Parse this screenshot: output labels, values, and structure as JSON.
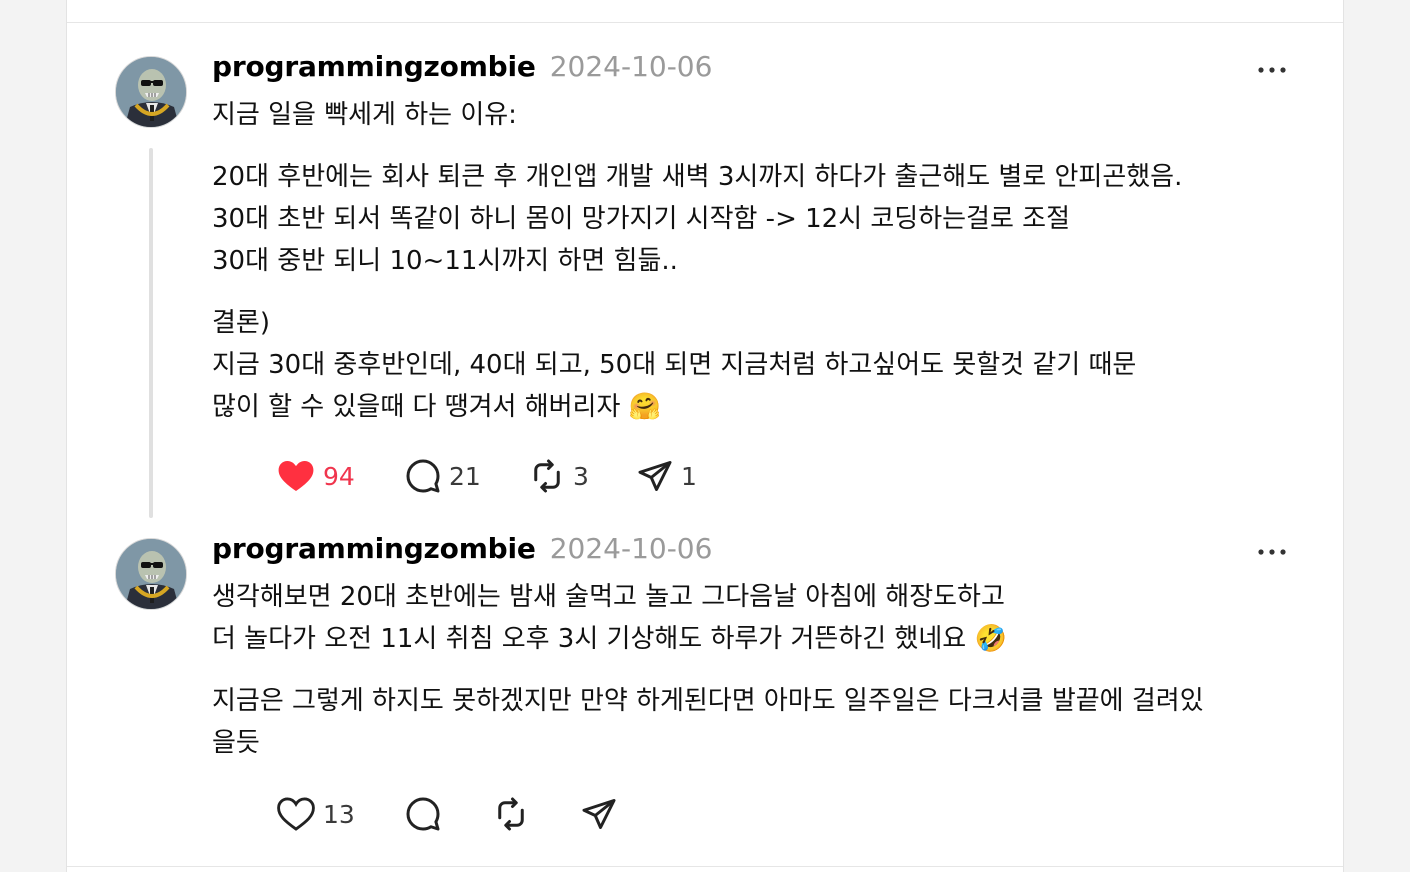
{
  "colors": {
    "like_active": "#ff3040",
    "date_gray": "#9a9a9a",
    "icon_dark": "#222222"
  },
  "posts": [
    {
      "username": "programmingzombie",
      "date": "2024-10-06",
      "more_icon": "more-dots-icon",
      "paragraphs": [
        "지금 일을 빡세게 하는 이유:",
        "20대 후반에는 회사 퇴큰 후 개인앱 개발 새벽 3시까지 하다가 출근해도 별로 안피곤했음.\n30대 초반 되서 똑같이 하니 몸이 망가지기 시작함 -> 12시 코딩하는걸로 조절\n30대 중반 되니 10~11시까지 하면 힘듦..",
        "결론)\n지금 30대 중후반인데, 40대 되고, 50대 되면 지금처럼 하고싶어도 못할것 같기 때문\n많이 할 수 있을때 다 땡겨서 해버리자 🤗"
      ],
      "actions": {
        "likes": "94",
        "liked": true,
        "comments": "21",
        "reposts": "3",
        "shares": "1"
      }
    },
    {
      "username": "programmingzombie",
      "date": "2024-10-06",
      "more_icon": "more-dots-icon",
      "paragraphs": [
        "생각해보면 20대 초반에는 밤새 술먹고 놀고 그다음날 아침에 해장도하고\n더 놀다가 오전 11시 취침 오후 3시 기상해도 하루가 거뜬하긴 했네요 🤣",
        "지금은 그렇게 하지도 못하겠지만 만약 하게된다면 아마도 일주일은 다크서클 발끝에 걸려있\n을듯"
      ],
      "actions": {
        "likes": "13",
        "liked": false,
        "comments": "",
        "reposts": "",
        "shares": ""
      }
    }
  ]
}
